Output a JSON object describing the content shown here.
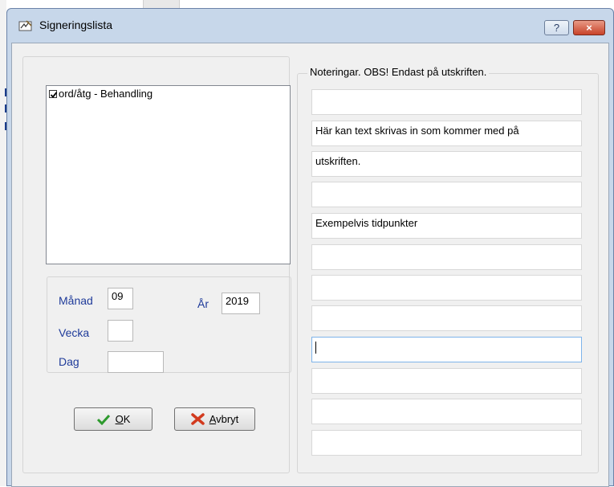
{
  "window": {
    "title": "Signeringslista",
    "help_label": "?",
    "close_label": "×"
  },
  "list": {
    "items": [
      {
        "label": "ord/åtg - Behandling",
        "checked": true
      }
    ]
  },
  "date": {
    "month_label": "Månad",
    "month_value": "09",
    "year_label": "År",
    "year_value": "2019",
    "week_label": "Vecka",
    "week_value": "",
    "day_label": "Dag",
    "day_value": ""
  },
  "buttons": {
    "ok_u": "O",
    "ok_rest": "K",
    "cancel_u": "A",
    "cancel_rest": "vbryt"
  },
  "notes": {
    "legend": "Noteringar. OBS! Endast på utskriften.",
    "rows": [
      "",
      "Här kan text skrivas in som kommer med på",
      "utskriften.",
      "",
      "Exempelvis tidpunkter",
      "",
      "",
      "",
      "",
      "",
      "",
      ""
    ],
    "focused_row": 8
  },
  "colors": {
    "label_blue": "#1f3b9a",
    "ok_green": "#2e9a2e",
    "cancel_red": "#d23a1e"
  }
}
